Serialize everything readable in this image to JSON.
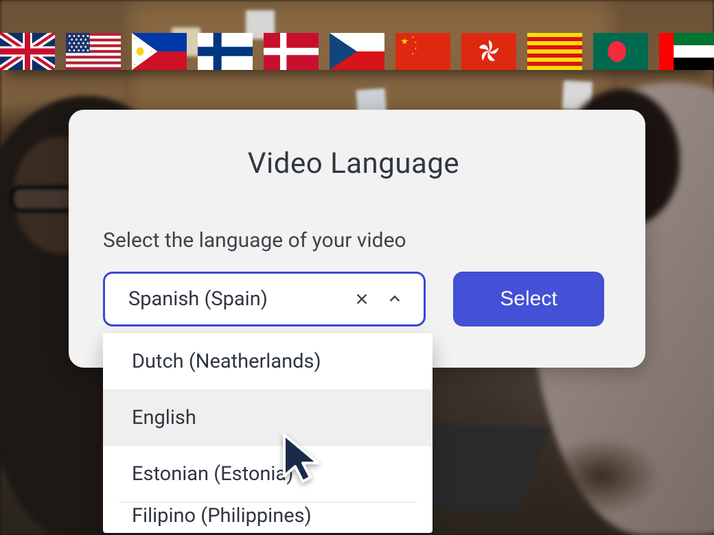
{
  "flags": [
    "united-kingdom",
    "united-states",
    "philippines",
    "finland",
    "denmark",
    "czech-republic",
    "china",
    "hong-kong",
    "catalonia",
    "bangladesh",
    "united-arab-emirates"
  ],
  "modal": {
    "title": "Video Language",
    "subtitle": "Select the language of your video",
    "selected_value": "Spanish (Spain)",
    "select_button": "Select"
  },
  "dropdown": {
    "options": [
      {
        "label": "Dutch (Neatherlands)",
        "hovered": false
      },
      {
        "label": "English",
        "hovered": true
      },
      {
        "label": "Estonian (Estonia)",
        "hovered": false
      },
      {
        "label": "Filipino (Philippines)",
        "hovered": false,
        "partial": true
      }
    ]
  },
  "colors": {
    "accent": "#4450d6",
    "focus_ring": "#3a46d6"
  }
}
